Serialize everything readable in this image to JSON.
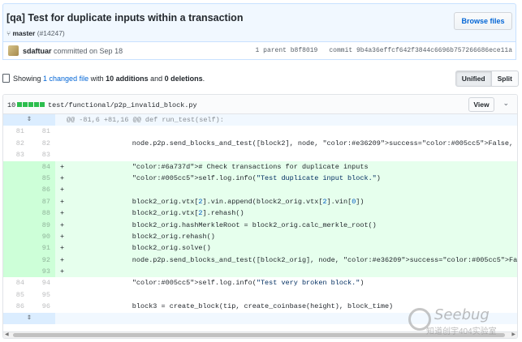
{
  "commit": {
    "title": "[qa] Test for duplicate inputs within a transaction",
    "branch": "master",
    "pr": "(#14247)",
    "browse_label": "Browse files",
    "author": "sdaftuar",
    "committed_text": "committed on Sep 18",
    "parent": "1 parent b8f8019",
    "sha": "commit 9b4a36effcf642f3844c6696b757266686ece11a"
  },
  "summary": {
    "prefix": "Showing ",
    "changed": "1 changed file",
    "mid": " with ",
    "additions": "10 additions",
    "and": " and ",
    "deletions": "0 deletions",
    "suffix": ".",
    "unified_label": "Unified",
    "split_label": "Split"
  },
  "file": {
    "count": "10",
    "path": "test/functional/p2p_invalid_block.py",
    "view_label": "View",
    "diffstat_color": "#2cbe4e"
  },
  "hunk_header": "@@ -81,6 +81,16 @@ def run_test(self):",
  "lines": [
    {
      "old": "81",
      "new": "81",
      "mark": "",
      "code": ""
    },
    {
      "old": "82",
      "new": "82",
      "mark": "",
      "code": "        node.p2p.send_blocks_and_test([block2], node, success=False, request_block=False, reject_reason='bad-txns-dupli"
    },
    {
      "old": "83",
      "new": "83",
      "mark": "",
      "code": ""
    },
    {
      "old": "",
      "new": "84",
      "mark": "+",
      "code": "        # Check transactions for duplicate inputs"
    },
    {
      "old": "",
      "new": "85",
      "mark": "+",
      "code": "        self.log.info(\"Test duplicate input block.\")"
    },
    {
      "old": "",
      "new": "86",
      "mark": "+",
      "code": ""
    },
    {
      "old": "",
      "new": "87",
      "mark": "+",
      "code": "        block2_orig.vtx[2].vin.append(block2_orig.vtx[2].vin[0])"
    },
    {
      "old": "",
      "new": "88",
      "mark": "+",
      "code": "        block2_orig.vtx[2].rehash()"
    },
    {
      "old": "",
      "new": "89",
      "mark": "+",
      "code": "        block2_orig.hashMerkleRoot = block2_orig.calc_merkle_root()"
    },
    {
      "old": "",
      "new": "90",
      "mark": "+",
      "code": "        block2_orig.rehash()"
    },
    {
      "old": "",
      "new": "91",
      "mark": "+",
      "code": "        block2_orig.solve()"
    },
    {
      "old": "",
      "new": "92",
      "mark": "+",
      "code": "        node.p2p.send_blocks_and_test([block2_orig], node, success=False, request_block=False, reject_reason='bad-txns-"
    },
    {
      "old": "",
      "new": "93",
      "mark": "+",
      "code": ""
    },
    {
      "old": "84",
      "new": "94",
      "mark": "",
      "code": "        self.log.info(\"Test very broken block.\")"
    },
    {
      "old": "85",
      "new": "95",
      "mark": "",
      "code": ""
    },
    {
      "old": "86",
      "new": "96",
      "mark": "",
      "code": "        block3 = create_block(tip, create_coinbase(height), block_time)"
    }
  ],
  "watermark": {
    "brand": "Seebug",
    "sub": "知道创宇404实验室"
  }
}
